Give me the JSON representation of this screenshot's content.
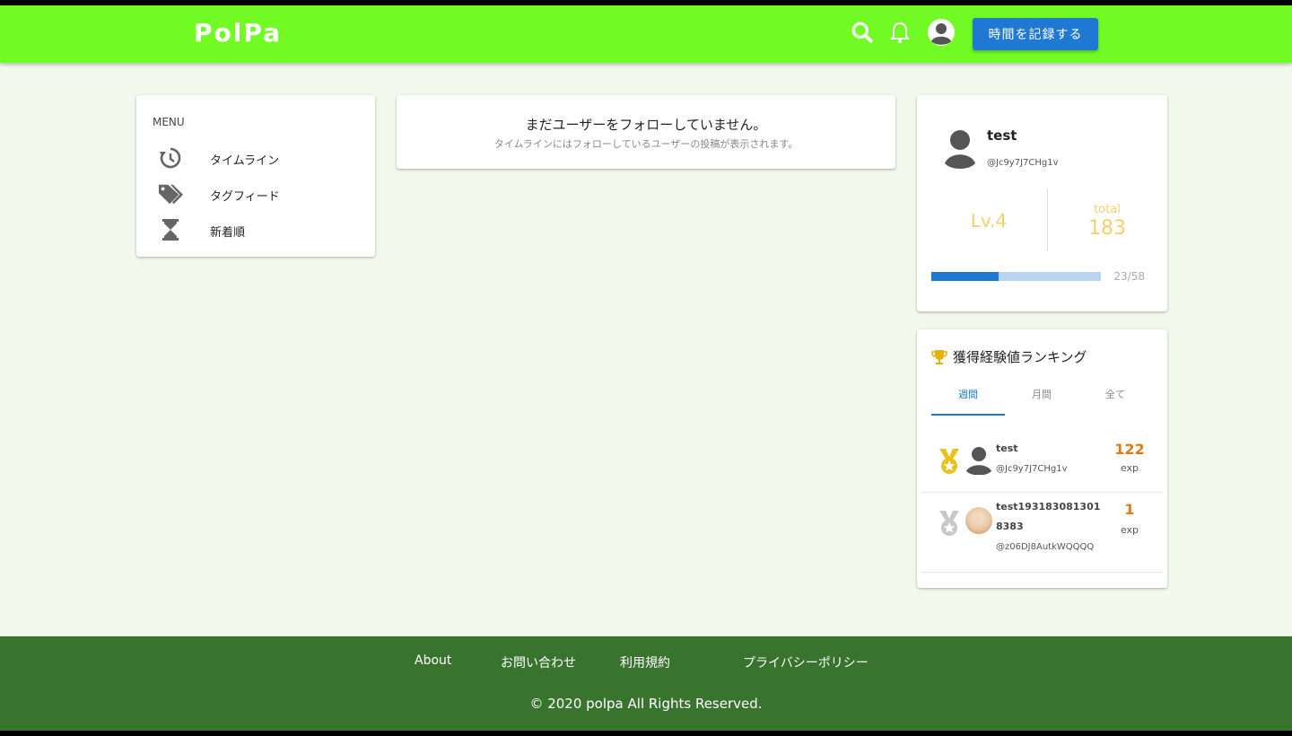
{
  "header": {
    "logo": "PolPa",
    "record_button": "時間を記録する",
    "icons": [
      "search-icon",
      "bell-icon",
      "account-icon"
    ],
    "bg_color": "#72fa24"
  },
  "menu": {
    "title": "MENU",
    "items": [
      {
        "label": "タイムライン",
        "icon": "history-icon"
      },
      {
        "label": "タグフィード",
        "icon": "tags-icon"
      },
      {
        "label": "新着順",
        "icon": "hourglass-icon"
      }
    ]
  },
  "timeline": {
    "empty_title": "まだユーザーをフォローしていません。",
    "empty_subtitle": "タイムラインにはフォローしているユーザーの投稿が表示されます。"
  },
  "profile": {
    "name": "test",
    "handle": "@Jc9y7J7CHg1v",
    "level": "Lv.4",
    "total_label": "total",
    "total": "183",
    "progress_text": "23/58",
    "progress_fraction": 0.397
  },
  "ranking": {
    "title": "獲得経験値ランキング",
    "tabs": [
      {
        "label": "週間",
        "active": true
      },
      {
        "label": "月間",
        "active": false
      },
      {
        "label": "全て",
        "active": false
      }
    ],
    "rows": [
      {
        "name": "test",
        "handle": "@Jc9y7J7CHg1v",
        "score": "122",
        "unit": "exp",
        "medal": "gold-medal-icon"
      },
      {
        "name": "test1931830813018383",
        "handle": "@z06DJ8AutkWQQQQ",
        "score": "1",
        "unit": "exp",
        "medal": "silver-medal-icon"
      }
    ]
  },
  "footer": {
    "links": [
      "About",
      "お問い合わせ",
      "利用規約",
      "プライバシーポリシー"
    ],
    "copyright": "© 2020 polpa All Rights Reserved.",
    "bg_color": "#38742d"
  }
}
